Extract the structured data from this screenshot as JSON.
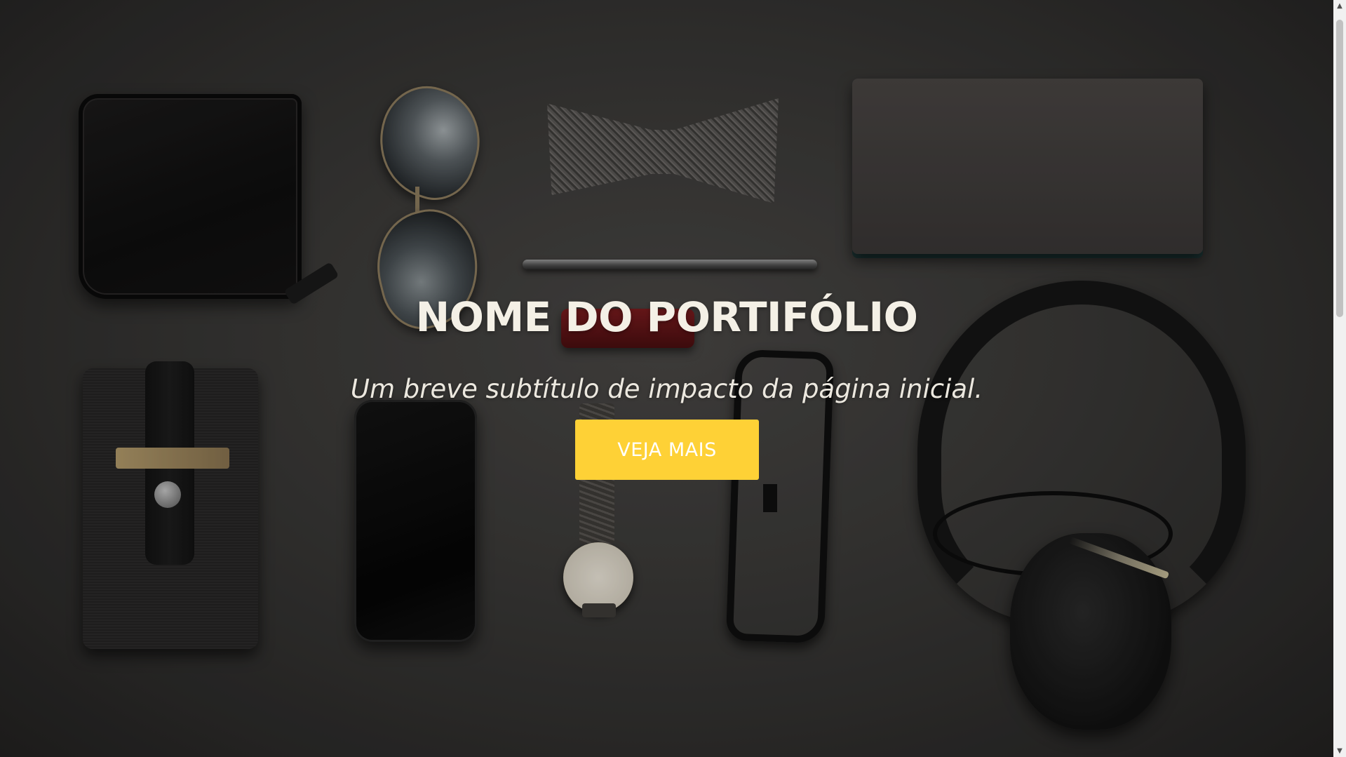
{
  "hero": {
    "title": "NOME DO PORTIFÓLIO",
    "subtitle": "Um breve subtítulo de impacto da página inicial.",
    "button_label": "VEJA MAIS",
    "button_color": "#fed136"
  },
  "scrollbar": {
    "up_icon": "▲",
    "down_icon": "▼"
  }
}
